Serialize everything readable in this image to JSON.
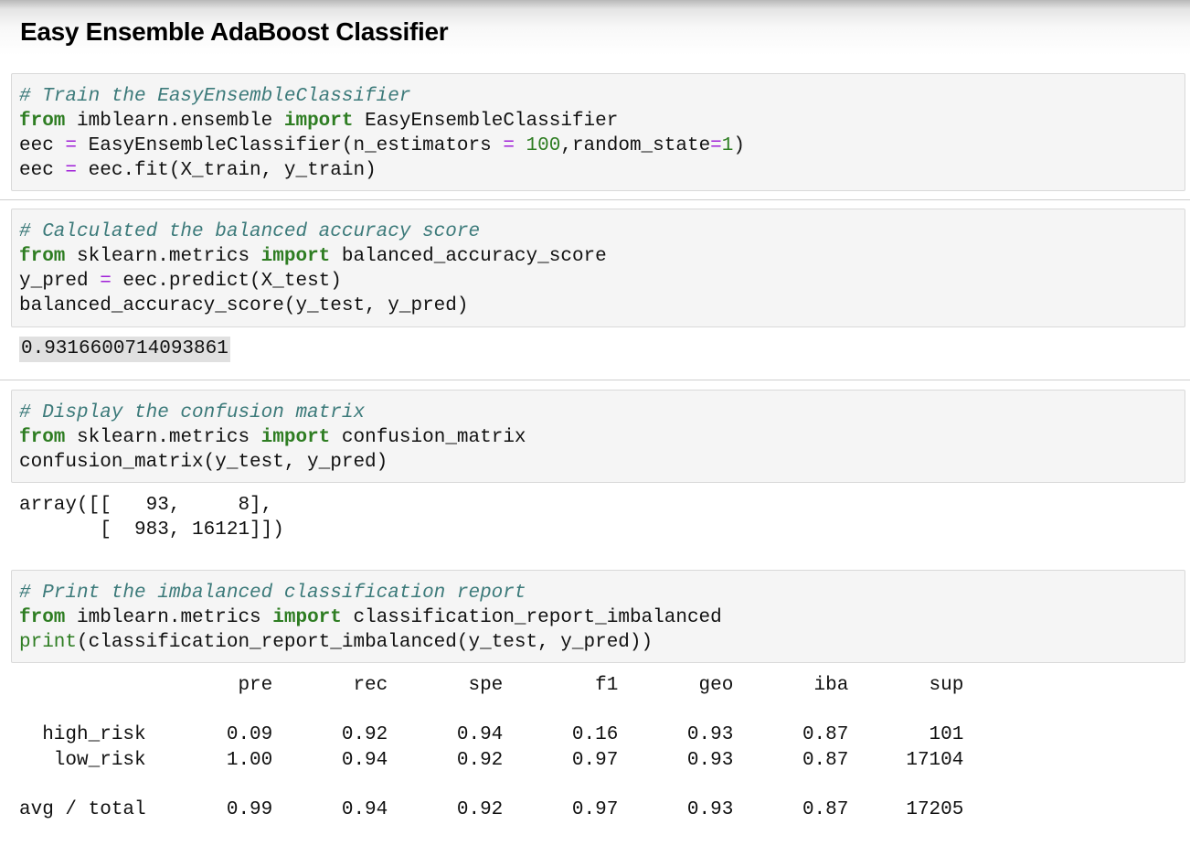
{
  "heading": "Easy Ensemble AdaBoost Classifier",
  "cells": {
    "train": {
      "comment": "# Train the EasyEnsembleClassifier",
      "l2_from": "from",
      "l2_module": " imblearn.ensemble ",
      "l2_import": "import",
      "l2_name": " EasyEnsembleClassifier",
      "l3_var": "eec ",
      "l3_eq": "=",
      "l3_call": " EasyEnsembleClassifier(n_estimators ",
      "l3_eq2": "=",
      "l3_sp": " ",
      "l3_num": "100",
      "l3_mid": ",random_state",
      "l3_eq3": "=",
      "l3_num2": "1",
      "l3_end": ")",
      "l4_var": "eec ",
      "l4_eq": "=",
      "l4_call": " eec.fit(X_train, y_train)"
    },
    "accuracy": {
      "comment": "# Calculated the balanced accuracy score",
      "l2_from": "from",
      "l2_module": " sklearn.metrics ",
      "l2_import": "import",
      "l2_name": " balanced_accuracy_score",
      "l3_var": "y_pred ",
      "l3_eq": "=",
      "l3_call": " eec.predict(X_test)",
      "l4_call": "balanced_accuracy_score(y_test, y_pred)",
      "output": "0.9316600714093861"
    },
    "confusion": {
      "comment": "# Display the confusion matrix",
      "l2_from": "from",
      "l2_module": " sklearn.metrics ",
      "l2_import": "import",
      "l2_name": " confusion_matrix",
      "l3_call": "confusion_matrix(y_test, y_pred)",
      "output_line1": "array([[   93,     8],",
      "output_line2": "       [  983, 16121]])"
    },
    "report": {
      "comment": "# Print the imbalanced classification report",
      "l2_from": "from",
      "l2_module": " imblearn.metrics ",
      "l2_import": "import",
      "l2_name": " classification_report_imbalanced",
      "l3_print": "print",
      "l3_call": "(classification_report_imbalanced(y_test, y_pred))"
    }
  },
  "report_output": {
    "header": "                   pre       rec       spe        f1       geo       iba       sup",
    "row_high": "  high_risk       0.09      0.92      0.94      0.16      0.93      0.87       101",
    "row_low": "   low_risk       1.00      0.94      0.92      0.97      0.93      0.87     17104",
    "row_avg": "avg / total       0.99      0.94      0.92      0.97      0.93      0.87     17205"
  }
}
